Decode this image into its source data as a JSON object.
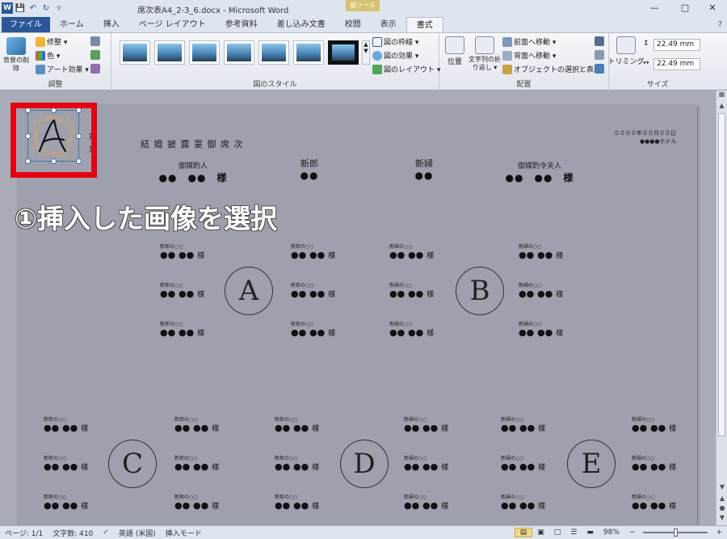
{
  "titlebar": {
    "title": "席次表A4_2-3_6.docx - Microsoft Word",
    "context_tool_label": "図ツール",
    "app_icon": "W",
    "qat": [
      "save-icon",
      "undo-icon",
      "redo-icon",
      "customize-icon"
    ],
    "window_buttons": [
      "minimize-icon",
      "maximize-icon",
      "close-icon"
    ]
  },
  "tabs": [
    "ファイル",
    "ホーム",
    "挿入",
    "ページ レイアウト",
    "参考資料",
    "差し込み文書",
    "校閲",
    "表示",
    "書式"
  ],
  "ribbon": {
    "adjust": {
      "label": "調整",
      "remove_bg": "背景の削除",
      "corrections": "修整 ▾",
      "color": "色 ▾",
      "artistic": "アート効果 ▾"
    },
    "styles": {
      "label": "図のスタイル",
      "border": "図の枠線 ▾",
      "effects": "図の効果 ▾",
      "layout": "図のレイアウト ▾"
    },
    "arrange": {
      "label": "配置",
      "position": "位置",
      "wrap_text": "文字列の折り返し ▾",
      "bring_forward": "前面へ移動 ▾",
      "send_backward": "背面へ移動 ▾",
      "selection_pane": "オブジェクトの選択と表示"
    },
    "size": {
      "label": "サイズ",
      "crop": "トリミング",
      "height": "22.49 mm",
      "width": "22.49 mm"
    }
  },
  "document": {
    "doc_title": "結 婚 披 露 宴 御 席 次",
    "date_line": "００００年００月００日",
    "hotel_line": "●●●●ホテル",
    "left_fragment_1": "家",
    "left_fragment_2": "家",
    "head_table": [
      {
        "role": "御媒酌人",
        "name": "●●　●●　様"
      },
      {
        "role": "新郎",
        "name": "●●"
      },
      {
        "role": "新婦",
        "name": "●●"
      },
      {
        "role": "御媒酌令夫人",
        "name": "●●　●●　様"
      }
    ],
    "guest_caption": "新郎の○○",
    "guest_caption_bride": "新婦の○○",
    "guest_name": "●● ●●",
    "honorific": "様",
    "tables": [
      "A",
      "B",
      "C",
      "D",
      "E"
    ],
    "logo_letter": "A"
  },
  "annotation": {
    "caption": "①挿入した画像を選択",
    "color": "#e50012"
  },
  "statusbar": {
    "page": "ページ: 1/1",
    "words": "文字数: 410",
    "language": "英語 (米国)",
    "mode": "挿入モード",
    "zoom": "98%"
  }
}
